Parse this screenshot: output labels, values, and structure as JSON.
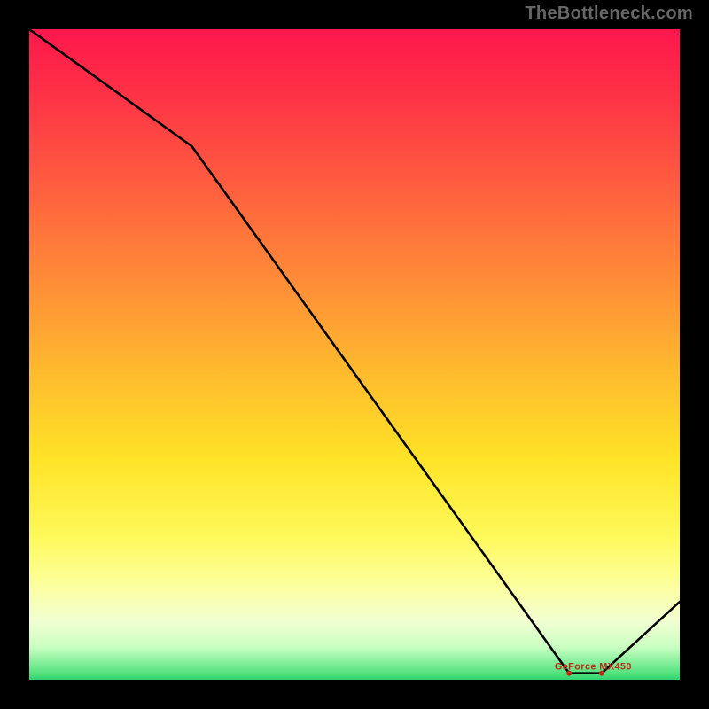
{
  "attribution": "TheBottleneck.com",
  "chart_data": {
    "type": "line",
    "title": "",
    "xlabel": "",
    "ylabel": "",
    "xlim": [
      0,
      100
    ],
    "ylim": [
      0,
      100
    ],
    "grid": false,
    "background_gradient": {
      "top_color": "#ff174c",
      "mid_color": "#ffe327",
      "bottom_color": "#2fd36f"
    },
    "x": [
      0,
      25,
      83,
      88,
      100
    ],
    "series": [
      {
        "name": "GeForce MX450",
        "values": [
          100,
          82,
          1,
          1,
          12
        ],
        "optimal_segment_x": [
          83,
          88
        ],
        "optimal_segment_y": [
          1,
          1
        ]
      }
    ],
    "legend_position": "inline-near-min"
  }
}
